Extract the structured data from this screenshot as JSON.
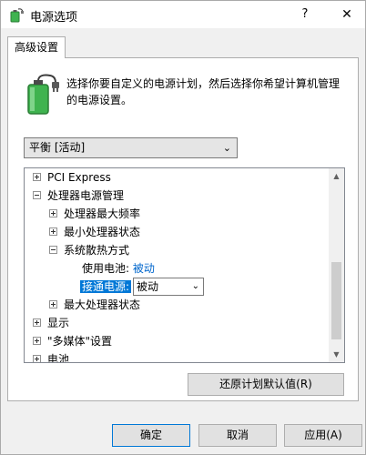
{
  "window": {
    "title": "电源选项",
    "help_label": "?",
    "close_label": "✕"
  },
  "tab": {
    "label": "高级设置"
  },
  "description": "选择你要自定义的电源计划，然后选择你希望计算机管理的电源设置。",
  "plan_select": {
    "value": "平衡 [活动]"
  },
  "tree": {
    "pci_express": "PCI Express",
    "processor_power": "处理器电源管理",
    "max_frequency": "处理器最大频率",
    "min_state": "最小处理器状态",
    "cooling_policy": "系统散热方式",
    "on_battery_label": "使用电池:",
    "on_battery_value": "被动",
    "plugged_in_label": "接通电源:",
    "plugged_in_value": "被动",
    "max_state": "最大处理器状态",
    "display": "显示",
    "multimedia": "\"多媒体\"设置",
    "battery": "电池"
  },
  "buttons": {
    "restore": "还原计划默认值(R)",
    "ok": "确定",
    "cancel": "取消",
    "apply": "应用(A)"
  },
  "colors": {
    "accent": "#0078d7",
    "link": "#0066cc",
    "battery_green": "#3fb34f"
  }
}
